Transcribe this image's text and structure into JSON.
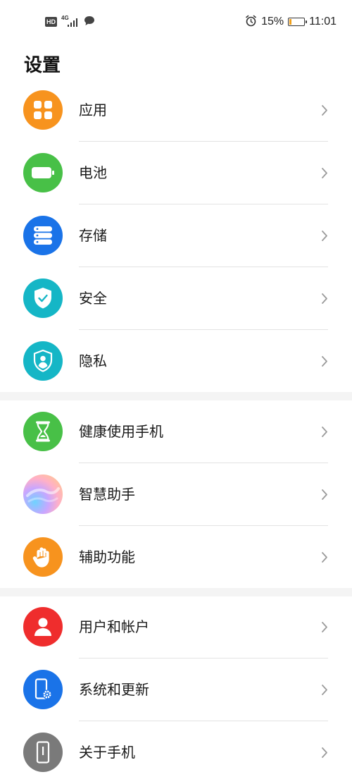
{
  "status": {
    "hd": "HD",
    "network": "4G",
    "battery_percent": "15%",
    "time": "11:01"
  },
  "page_title": "设置",
  "groups": [
    [
      {
        "label": "应用",
        "icon": "apps-icon",
        "color": "#f7931e"
      },
      {
        "label": "电池",
        "icon": "battery-icon",
        "color": "#48c047"
      },
      {
        "label": "存储",
        "icon": "storage-icon",
        "color": "#1a73e8"
      },
      {
        "label": "安全",
        "icon": "security-shield-icon",
        "color": "#15b6c6"
      },
      {
        "label": "隐私",
        "icon": "privacy-icon",
        "color": "#15b6c6"
      }
    ],
    [
      {
        "label": "健康使用手机",
        "icon": "hourglass-icon",
        "color": "#48c047"
      },
      {
        "label": "智慧助手",
        "icon": "assistant-orb-icon",
        "color": "#c8a0f0"
      },
      {
        "label": "辅助功能",
        "icon": "hand-icon",
        "color": "#f7931e"
      }
    ],
    [
      {
        "label": "用户和帐户",
        "icon": "user-icon",
        "color": "#ef2d2d"
      },
      {
        "label": "系统和更新",
        "icon": "system-update-icon",
        "color": "#1a73e8"
      },
      {
        "label": "关于手机",
        "icon": "phone-info-icon",
        "color": "#7a7a7a"
      }
    ]
  ]
}
